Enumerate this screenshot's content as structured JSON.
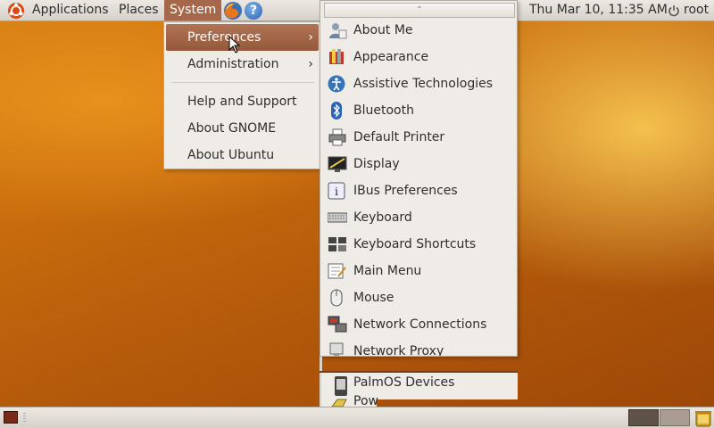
{
  "top_panel": {
    "menus": [
      "Applications",
      "Places",
      "System"
    ],
    "active_menu": "System",
    "clock": "Thu Mar 10, 11:35 AM",
    "user": "root"
  },
  "system_menu": {
    "items": [
      {
        "label": "Preferences",
        "submenu": true,
        "active": true
      },
      {
        "label": "Administration",
        "submenu": true,
        "active": false
      },
      {
        "label": "Help and Support",
        "submenu": false
      },
      {
        "label": "About GNOME",
        "submenu": false
      },
      {
        "label": "About Ubuntu",
        "submenu": false
      }
    ],
    "submenu_arrow": "›"
  },
  "preferences_menu": {
    "scroll_up_glyph": "⌃",
    "items": [
      {
        "label": "About Me",
        "icon": "about-me-icon"
      },
      {
        "label": "Appearance",
        "icon": "appearance-icon"
      },
      {
        "label": "Assistive Technologies",
        "icon": "accessibility-icon"
      },
      {
        "label": "Bluetooth",
        "icon": "bluetooth-icon"
      },
      {
        "label": "Default Printer",
        "icon": "printer-icon"
      },
      {
        "label": "Display",
        "icon": "display-icon"
      },
      {
        "label": "IBus Preferences",
        "icon": "ibus-icon"
      },
      {
        "label": "Keyboard",
        "icon": "keyboard-icon"
      },
      {
        "label": "Keyboard Shortcuts",
        "icon": "keyboard-shortcuts-icon"
      },
      {
        "label": "Main Menu",
        "icon": "main-menu-icon"
      },
      {
        "label": "Mouse",
        "icon": "mouse-icon"
      },
      {
        "label": "Network Connections",
        "icon": "network-connections-icon"
      },
      {
        "label": "Network Proxy",
        "icon": "network-proxy-icon"
      },
      {
        "label": "PalmOS Devices",
        "icon": "palm-device-icon"
      },
      {
        "label": "Pow",
        "icon": "power-management-icon"
      }
    ]
  },
  "colors": {
    "panel": "#e6e2db",
    "menu_bg": "#efebe7",
    "highlight": "#a6684a",
    "desktop": "#c96d0d"
  }
}
